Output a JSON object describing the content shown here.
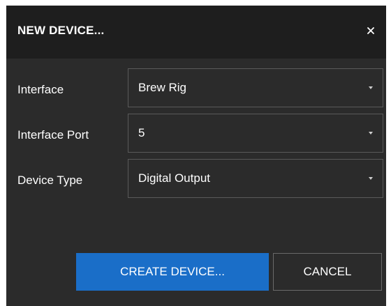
{
  "dialog": {
    "title": "NEW DEVICE...",
    "close_label": "×"
  },
  "form": {
    "interface": {
      "label": "Interface",
      "value": "Brew Rig"
    },
    "interface_port": {
      "label": "Interface Port",
      "value": "5"
    },
    "device_type": {
      "label": "Device Type",
      "value": "Digital Output"
    }
  },
  "buttons": {
    "create_label": "CREATE DEVICE...",
    "cancel_label": "CANCEL"
  },
  "colors": {
    "dialog_bg": "#2b2b2b",
    "titlebar_bg": "#1e1e1e",
    "primary": "#1a6ec8",
    "border": "#5a5a5a"
  },
  "icons": {
    "close": "close-icon",
    "dropdown": "chevron-down-icon"
  }
}
